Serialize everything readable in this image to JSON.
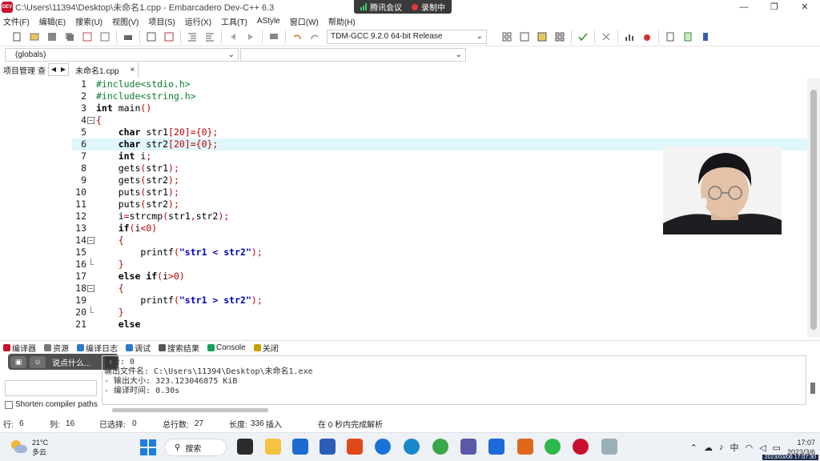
{
  "window": {
    "title": "C:\\Users\\11394\\Desktop\\未命名1.cpp - Embarcadero Dev-C++ 6.3",
    "controls": [
      "—",
      "❐",
      "✕"
    ]
  },
  "meeting": {
    "app_label": "腾讯会议",
    "record_label": "录制中"
  },
  "menu": [
    "文件(F)",
    "编辑(E)",
    "搜索(U)",
    "视图(V)",
    "项目(S)",
    "运行(X)",
    "工具(T)",
    "AStyle",
    "窗口(W)",
    "帮助(H)"
  ],
  "toolbar": {
    "compiler": "TDM-GCC 9.2.0 64-bit Release"
  },
  "scope": {
    "globals": "(globals)",
    "second": ""
  },
  "left_panel": {
    "tab_label": "项目管理",
    "tab_cut": "查"
  },
  "file_tab": {
    "name": "未命名1.cpp",
    "close": "×"
  },
  "editor": {
    "highlight_line": 6,
    "lines": [
      {
        "n": "1",
        "fold": "",
        "indent": 0,
        "tokens": [
          [
            "pp",
            "#include<stdio.h>"
          ]
        ]
      },
      {
        "n": "2",
        "fold": "",
        "indent": 0,
        "tokens": [
          [
            "pp",
            "#include<string.h>"
          ]
        ]
      },
      {
        "n": "3",
        "fold": "",
        "indent": 0,
        "tokens": [
          [
            "kw",
            "int"
          ],
          [
            "",
            " main"
          ],
          [
            "red",
            "()"
          ]
        ]
      },
      {
        "n": "4",
        "fold": "−",
        "indent": 0,
        "tokens": [
          [
            "red",
            "{"
          ]
        ]
      },
      {
        "n": "5",
        "fold": "",
        "indent": 4,
        "tokens": [
          [
            "kw",
            "char"
          ],
          [
            "",
            " str1"
          ],
          [
            "red",
            "[20]={0};"
          ]
        ]
      },
      {
        "n": "6",
        "fold": "",
        "indent": 4,
        "tokens": [
          [
            "kw",
            "char"
          ],
          [
            "",
            " str2"
          ],
          [
            "red",
            "[20]={0};"
          ]
        ]
      },
      {
        "n": "7",
        "fold": "",
        "indent": 4,
        "tokens": [
          [
            "kw",
            "int"
          ],
          [
            "",
            " i"
          ],
          [
            "red",
            ";"
          ]
        ]
      },
      {
        "n": "8",
        "fold": "",
        "indent": 4,
        "tokens": [
          [
            "",
            "gets"
          ],
          [
            "red",
            "("
          ],
          [
            "",
            "str1"
          ],
          [
            "red",
            ");"
          ]
        ]
      },
      {
        "n": "9",
        "fold": "",
        "indent": 4,
        "tokens": [
          [
            "",
            "gets"
          ],
          [
            "red",
            "("
          ],
          [
            "",
            "str2"
          ],
          [
            "red",
            ");"
          ]
        ]
      },
      {
        "n": "10",
        "fold": "",
        "indent": 4,
        "tokens": [
          [
            "",
            "puts"
          ],
          [
            "red",
            "("
          ],
          [
            "",
            "str1"
          ],
          [
            "red",
            ");"
          ]
        ]
      },
      {
        "n": "11",
        "fold": "",
        "indent": 4,
        "tokens": [
          [
            "",
            "puts"
          ],
          [
            "red",
            "("
          ],
          [
            "",
            "str2"
          ],
          [
            "red",
            ");"
          ]
        ]
      },
      {
        "n": "12",
        "fold": "",
        "indent": 4,
        "tokens": [
          [
            "",
            "i"
          ],
          [
            "red",
            "="
          ],
          [
            "",
            "strcmp"
          ],
          [
            "red",
            "("
          ],
          [
            "",
            "str1"
          ],
          [
            "red",
            ","
          ],
          [
            "",
            "str2"
          ],
          [
            "red",
            ");"
          ]
        ]
      },
      {
        "n": "13",
        "fold": "",
        "indent": 4,
        "tokens": [
          [
            "kw",
            "if"
          ],
          [
            "red",
            "("
          ],
          [
            "",
            "i"
          ],
          [
            "red",
            "<0)"
          ]
        ]
      },
      {
        "n": "14",
        "fold": "−",
        "indent": 4,
        "tokens": [
          [
            "red",
            "{"
          ]
        ]
      },
      {
        "n": "15",
        "fold": "",
        "indent": 8,
        "tokens": [
          [
            "",
            "printf"
          ],
          [
            "red",
            "("
          ],
          [
            "str",
            "\"str1 < str2\""
          ],
          [
            "red",
            ");"
          ]
        ]
      },
      {
        "n": "16",
        "fold": "end",
        "indent": 4,
        "tokens": [
          [
            "red",
            "}"
          ]
        ]
      },
      {
        "n": "17",
        "fold": "",
        "indent": 4,
        "tokens": [
          [
            "kw",
            "else if"
          ],
          [
            "red",
            "("
          ],
          [
            "",
            "i"
          ],
          [
            "red",
            ">0)"
          ]
        ]
      },
      {
        "n": "18",
        "fold": "−",
        "indent": 4,
        "tokens": [
          [
            "red",
            "{"
          ]
        ]
      },
      {
        "n": "19",
        "fold": "",
        "indent": 8,
        "tokens": [
          [
            "",
            "printf"
          ],
          [
            "red",
            "("
          ],
          [
            "str",
            "\"str1 > str2\""
          ],
          [
            "red",
            ");"
          ]
        ]
      },
      {
        "n": "20",
        "fold": "end",
        "indent": 4,
        "tokens": [
          [
            "red",
            "}"
          ]
        ]
      },
      {
        "n": "21",
        "fold": "",
        "indent": 4,
        "tokens": [
          [
            "kw",
            "else"
          ]
        ]
      }
    ]
  },
  "bottom_tabs": [
    {
      "label": "编译器",
      "color": "#c8102e"
    },
    {
      "label": "资源",
      "color": "#777777"
    },
    {
      "label": "编译日志",
      "color": "#2a7bd0"
    },
    {
      "label": "调试",
      "color": "#2a7bd0"
    },
    {
      "label": "搜索结果",
      "color": "#555555"
    },
    {
      "label": "Console",
      "color": "#1aa05a"
    },
    {
      "label": "关闭",
      "color": "#c8a000"
    }
  ],
  "float_toolbar": {
    "chat_placeholder": "说点什么...",
    "collapse": "‹"
  },
  "output_lines": [
    "警告: 0",
    "输出文件名: C:\\Users\\11394\\Desktop\\未命名1.exe",
    "- 输出大小: 323.123046875 KiB",
    "- 编译时间: 0.30s"
  ],
  "shorten_label": "Shorten compiler paths",
  "status": {
    "row_label": "行:",
    "row": "6",
    "col_label": "列:",
    "col": "16",
    "sel_label": "已选择:",
    "sel": "0",
    "total_label": "总行数:",
    "total": "27",
    "len_label": "长度:",
    "len": "336",
    "mode": "插入",
    "parse": "在 0 秒内完成解析"
  },
  "taskbar": {
    "temperature": "21°C",
    "weather": "多云",
    "search": "搜索",
    "ime": "中",
    "time": "17:07",
    "date": "2023/3/6",
    "recording_stamp": "2023/03/06 17:07:30"
  }
}
